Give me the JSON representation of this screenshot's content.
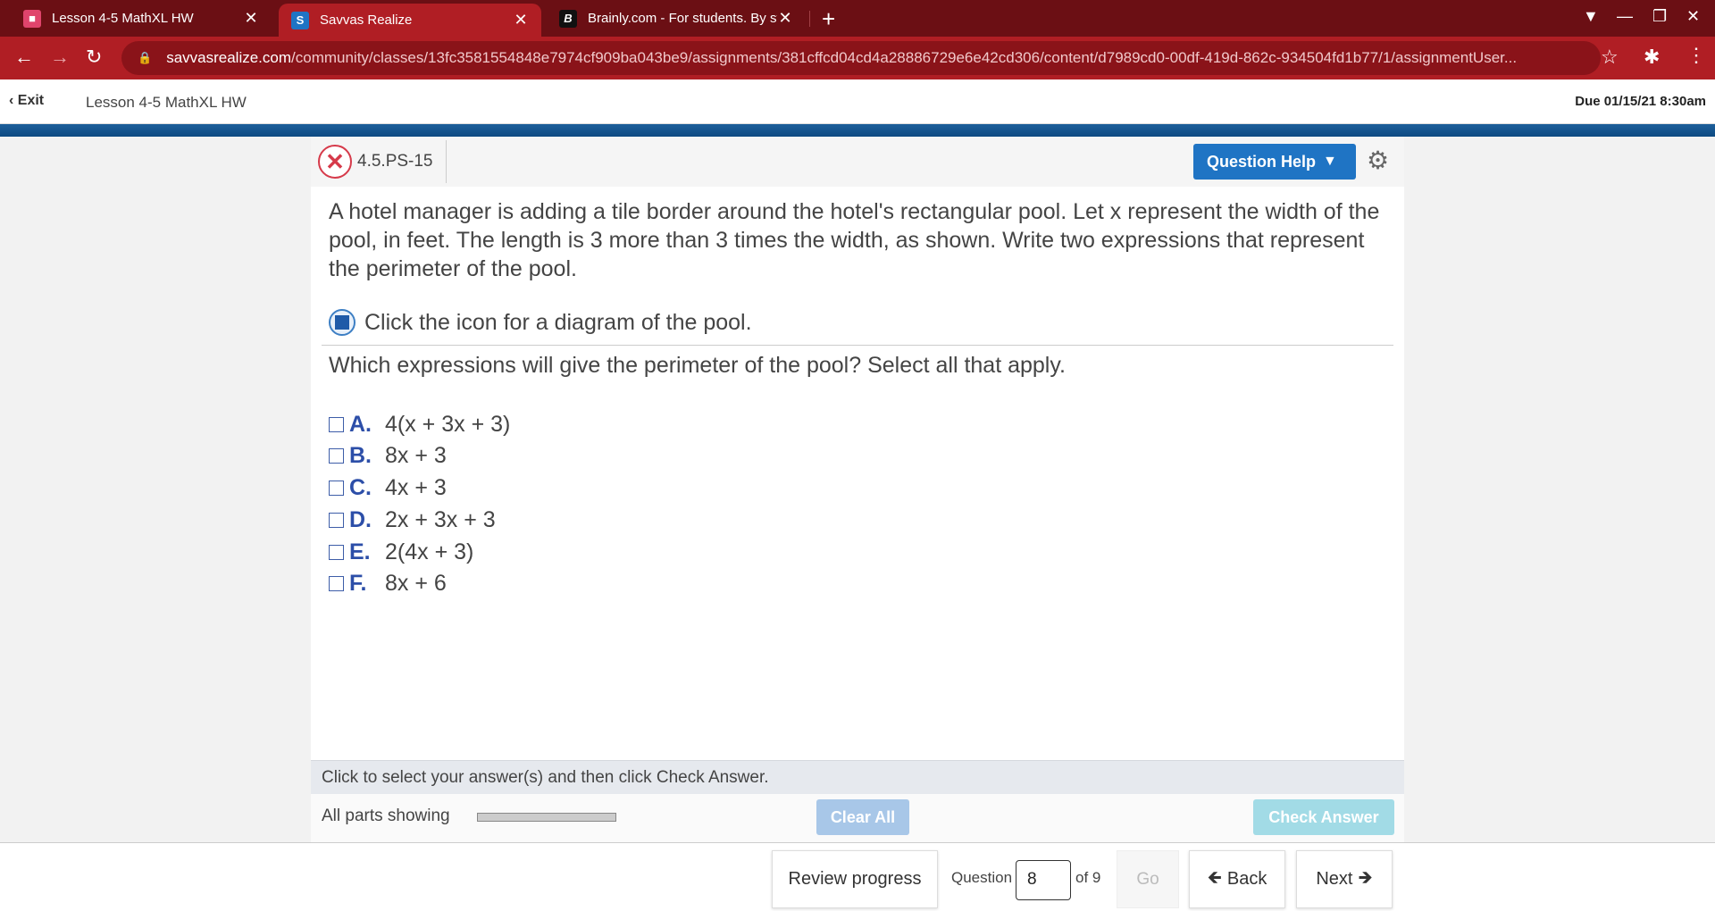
{
  "browser": {
    "tabs": [
      {
        "title": "Lesson 4-5 MathXL HW",
        "favicon": "classroom-icon"
      },
      {
        "title": "Savvas Realize",
        "favicon": "savvas-icon"
      },
      {
        "title": "Brainly.com - For students. By st",
        "favicon": "brainly-icon"
      }
    ],
    "url_host": "savvasrealize.com",
    "url_path": "/community/classes/13fc3581554848e7974cf909ba043be9/assignments/381cffcd04cd4a28886729e6e42cd306/content/d7989cd0-00df-419d-862c-934504fd1b77/1/assignmentUser..."
  },
  "header": {
    "exit_label": "Exit",
    "lesson_title": "Lesson 4-5 MathXL HW",
    "due": "Due 01/15/21 8:30am"
  },
  "question": {
    "id": "4.5.PS-15",
    "help_label": "Question Help",
    "text": "A hotel manager is adding a tile border around the hotel's rectangular pool. Let x represent the width of the pool, in feet. The length is 3 more than 3 times the width, as shown. Write two expressions that represent the perimeter of the pool.",
    "diagram_label": "Click the icon for a diagram of the pool.",
    "prompt": "Which expressions will give the perimeter of the pool? Select all that apply.",
    "choices": [
      {
        "letter": "A.",
        "expr": "4(x + 3x + 3)"
      },
      {
        "letter": "B.",
        "expr": "8x + 3"
      },
      {
        "letter": "C.",
        "expr": "4x + 3"
      },
      {
        "letter": "D.",
        "expr": "2x + 3x + 3"
      },
      {
        "letter": "E.",
        "expr": "2(4x + 3)"
      },
      {
        "letter": "F.",
        "expr": "8x + 6"
      }
    ],
    "hint": "Click to select your answer(s) and then click Check Answer.",
    "all_parts": "All parts showing",
    "clear_all": "Clear All",
    "check_answer": "Check Answer"
  },
  "footer": {
    "review_progress": "Review progress",
    "question_label": "Question",
    "question_number": "8",
    "of_total": "of 9",
    "go": "Go",
    "back": "Back",
    "next": "Next"
  },
  "colors": {
    "tabbar": "#6b0f14",
    "addrbar": "#b01e24",
    "accent_blue": "#1f74c4",
    "choice_letter": "#2c4ea8"
  }
}
